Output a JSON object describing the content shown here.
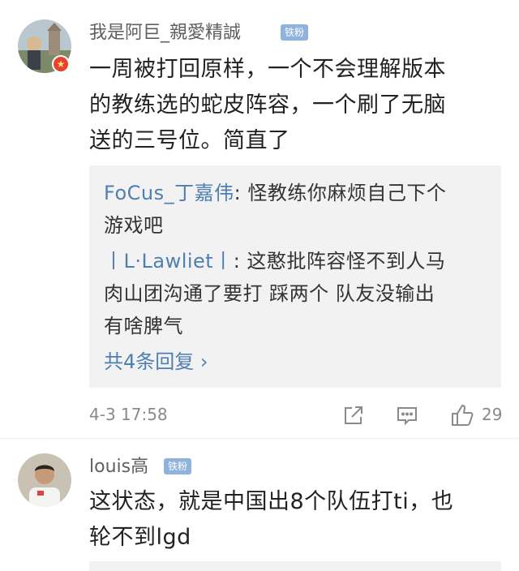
{
  "comments": [
    {
      "username": "我是阿巨_親愛精誠",
      "badge": "铁粉",
      "content_lines": [
        "一周被打回原样，一个不会理解版本",
        "的教练选的蛇皮阵容，一个刷了无脑",
        "送的三号位。简直了"
      ],
      "replies": [
        {
          "user": "FoCus_丁嘉伟",
          "lines": [
            ": 怪教练你麻烦自己下个",
            "游戏吧"
          ]
        },
        {
          "user": "丨L·Lawliet丨",
          "lines": [
            ": 这憨批阵容怪不到人马",
            "肉山团沟通了要打 踩两个 队友没输出",
            "有啥脾气"
          ]
        }
      ],
      "more_replies": "共4条回复 ›",
      "timestamp": "4-3 17:58",
      "like_count": "29"
    },
    {
      "username": "louis高",
      "badge": "铁粉",
      "content_lines": [
        "这状态，就是中国出8个队伍打ti，也",
        "轮不到lgd"
      ]
    }
  ],
  "colors": {
    "link": "#4e7fb3",
    "badge": "#8fb3dc",
    "verified": "#e8412f",
    "reply_bg": "#f2f2f2"
  },
  "icons": [
    "share-icon",
    "comment-icon",
    "thumbs-up-icon",
    "verified-badge-icon"
  ]
}
